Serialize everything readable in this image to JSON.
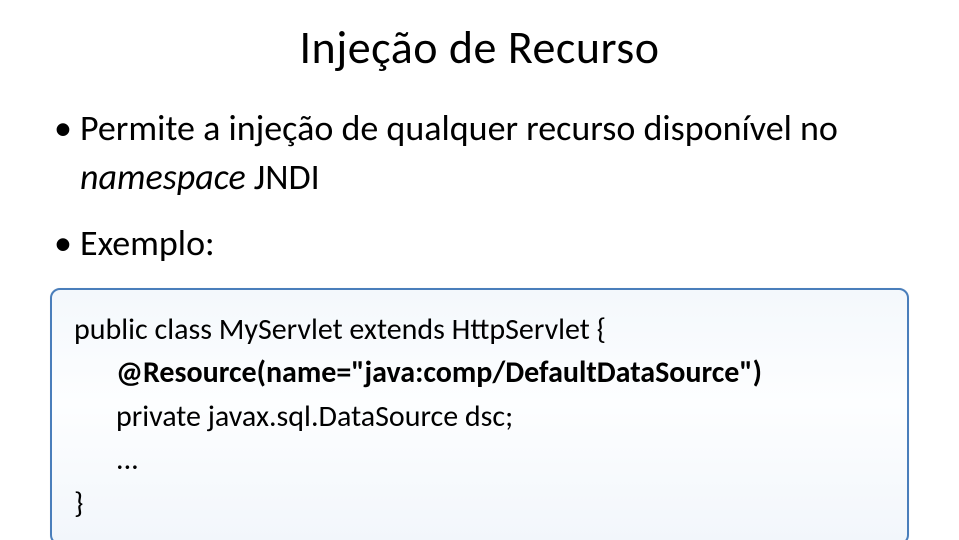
{
  "title": "Injeção de Recurso",
  "bullets": {
    "b1_pre": "Permite a injeção de qualquer recurso disponível no ",
    "b1_italic": "namespace",
    "b1_post": " JNDI",
    "b2": "Exemplo:"
  },
  "code": {
    "line1": "public class MyServlet extends HttpServlet {",
    "line2": "@Resource(name=\"java:comp/DefaultDataSource\")",
    "line3": "private javax.sql.DataSource dsc;  ",
    "line4": "...",
    "line5": "}"
  }
}
